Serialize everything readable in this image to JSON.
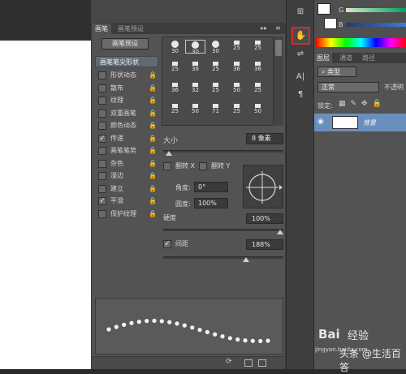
{
  "brush_panel": {
    "tabs": [
      "画笔",
      "画笔预设"
    ],
    "preset_button": "画笔预设",
    "tip_shape_title": "画笔笔尖形状",
    "options": [
      {
        "label": "形状动态",
        "checked": false
      },
      {
        "label": "散布",
        "checked": false
      },
      {
        "label": "纹理",
        "checked": false
      },
      {
        "label": "双重画笔",
        "checked": false
      },
      {
        "label": "颜色动态",
        "checked": false
      },
      {
        "label": "传递",
        "checked": true
      },
      {
        "label": "画笔笔势",
        "checked": false
      },
      {
        "label": "杂色",
        "checked": false
      },
      {
        "label": "湿边",
        "checked": false
      },
      {
        "label": "建立",
        "checked": false
      },
      {
        "label": "平滑",
        "checked": true
      },
      {
        "label": "保护纹理",
        "checked": false
      }
    ],
    "brush_sizes": [
      [
        "30",
        "30",
        "30",
        "25",
        "25"
      ],
      [
        "25",
        "36",
        "25",
        "36",
        "36"
      ],
      [
        "36",
        "32",
        "25",
        "50",
        "25"
      ],
      [
        "25",
        "50",
        "71",
        "25",
        "50"
      ]
    ],
    "selected_brush": {
      "row": 0,
      "col": 1
    },
    "size_label": "大小",
    "size_value": "8 像素",
    "size_level": 0.02,
    "flip_x": "翻转 X",
    "flip_y": "翻转 Y",
    "angle_label": "角度:",
    "angle_value": "0°",
    "roundness_label": "圆度:",
    "roundness_value": "100%",
    "hardness_label": "硬度",
    "hardness_value": "100%",
    "hardness_level": 1.0,
    "spacing_label": "间距",
    "spacing_value": "188%",
    "spacing_checked": true,
    "spacing_level": 0.7
  },
  "right_panel": {
    "color_labels": [
      "G",
      "B"
    ],
    "layer_tabs": [
      "图层",
      "通道",
      "路径"
    ],
    "filter_value": "类型",
    "blend_mode": "正常",
    "opacity_label": "不透明",
    "lock_label": "锁定:",
    "layer_name": "背景"
  },
  "watermark": {
    "brand": "Bai",
    "product": "经验",
    "site": "jingyan.baidu.com",
    "caption": "头条 @生活百答"
  },
  "colors": {
    "highlight": "#d82a2a",
    "layer_selected": "#6b8fbd",
    "panel": "#535353"
  }
}
